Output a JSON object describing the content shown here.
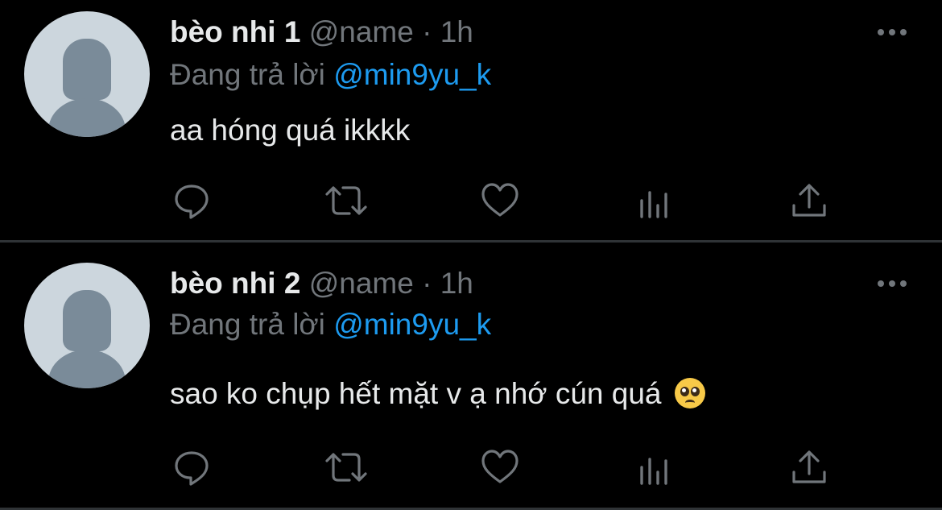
{
  "tweets": [
    {
      "display_name": "bèo nhi 1",
      "handle": "@name",
      "separator": "·",
      "time": "1h",
      "reply_prefix": "Đang trả lời",
      "reply_to": "@min9yu_k",
      "text": "aa hóng quá ikkkk",
      "emoji": null
    },
    {
      "display_name": "bèo nhi 2",
      "handle": "@name",
      "separator": "·",
      "time": "1h",
      "reply_prefix": "Đang trả lời",
      "reply_to": "@min9yu_k",
      "text": "sao ko chụp hết mặt v ạ nhớ cún quá",
      "emoji": "pleading-face"
    }
  ],
  "icons": {
    "reply": "reply-icon",
    "retweet": "retweet-icon",
    "like": "heart-icon",
    "views": "views-icon",
    "share": "share-icon",
    "more": "more-icon"
  },
  "colors": {
    "background": "#000000",
    "text": "#e7e9ea",
    "secondary": "#71767b",
    "mention": "#1d9bf0",
    "divider": "#2f3336"
  }
}
